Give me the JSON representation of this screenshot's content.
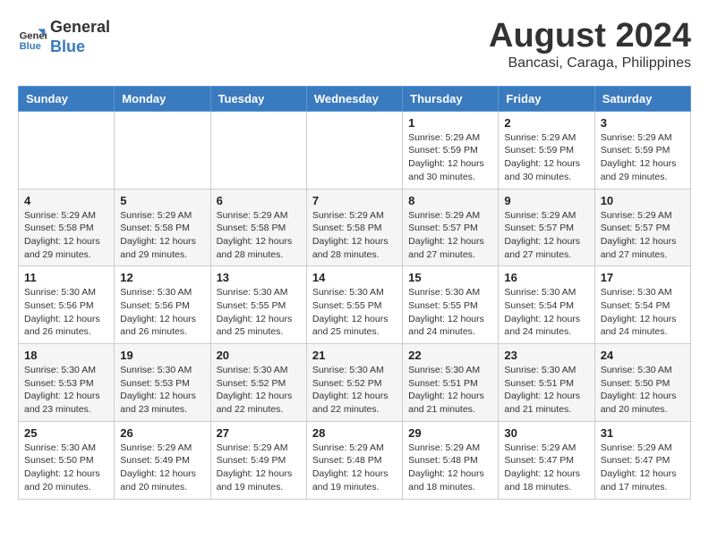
{
  "header": {
    "logo_line1": "General",
    "logo_line2": "Blue",
    "month_title": "August 2024",
    "location": "Bancasi, Caraga, Philippines"
  },
  "weekdays": [
    "Sunday",
    "Monday",
    "Tuesday",
    "Wednesday",
    "Thursday",
    "Friday",
    "Saturday"
  ],
  "weeks": [
    [
      {
        "day": "",
        "info": ""
      },
      {
        "day": "",
        "info": ""
      },
      {
        "day": "",
        "info": ""
      },
      {
        "day": "",
        "info": ""
      },
      {
        "day": "1",
        "info": "Sunrise: 5:29 AM\nSunset: 5:59 PM\nDaylight: 12 hours\nand 30 minutes."
      },
      {
        "day": "2",
        "info": "Sunrise: 5:29 AM\nSunset: 5:59 PM\nDaylight: 12 hours\nand 30 minutes."
      },
      {
        "day": "3",
        "info": "Sunrise: 5:29 AM\nSunset: 5:59 PM\nDaylight: 12 hours\nand 29 minutes."
      }
    ],
    [
      {
        "day": "4",
        "info": "Sunrise: 5:29 AM\nSunset: 5:58 PM\nDaylight: 12 hours\nand 29 minutes."
      },
      {
        "day": "5",
        "info": "Sunrise: 5:29 AM\nSunset: 5:58 PM\nDaylight: 12 hours\nand 29 minutes."
      },
      {
        "day": "6",
        "info": "Sunrise: 5:29 AM\nSunset: 5:58 PM\nDaylight: 12 hours\nand 28 minutes."
      },
      {
        "day": "7",
        "info": "Sunrise: 5:29 AM\nSunset: 5:58 PM\nDaylight: 12 hours\nand 28 minutes."
      },
      {
        "day": "8",
        "info": "Sunrise: 5:29 AM\nSunset: 5:57 PM\nDaylight: 12 hours\nand 27 minutes."
      },
      {
        "day": "9",
        "info": "Sunrise: 5:29 AM\nSunset: 5:57 PM\nDaylight: 12 hours\nand 27 minutes."
      },
      {
        "day": "10",
        "info": "Sunrise: 5:29 AM\nSunset: 5:57 PM\nDaylight: 12 hours\nand 27 minutes."
      }
    ],
    [
      {
        "day": "11",
        "info": "Sunrise: 5:30 AM\nSunset: 5:56 PM\nDaylight: 12 hours\nand 26 minutes."
      },
      {
        "day": "12",
        "info": "Sunrise: 5:30 AM\nSunset: 5:56 PM\nDaylight: 12 hours\nand 26 minutes."
      },
      {
        "day": "13",
        "info": "Sunrise: 5:30 AM\nSunset: 5:55 PM\nDaylight: 12 hours\nand 25 minutes."
      },
      {
        "day": "14",
        "info": "Sunrise: 5:30 AM\nSunset: 5:55 PM\nDaylight: 12 hours\nand 25 minutes."
      },
      {
        "day": "15",
        "info": "Sunrise: 5:30 AM\nSunset: 5:55 PM\nDaylight: 12 hours\nand 24 minutes."
      },
      {
        "day": "16",
        "info": "Sunrise: 5:30 AM\nSunset: 5:54 PM\nDaylight: 12 hours\nand 24 minutes."
      },
      {
        "day": "17",
        "info": "Sunrise: 5:30 AM\nSunset: 5:54 PM\nDaylight: 12 hours\nand 24 minutes."
      }
    ],
    [
      {
        "day": "18",
        "info": "Sunrise: 5:30 AM\nSunset: 5:53 PM\nDaylight: 12 hours\nand 23 minutes."
      },
      {
        "day": "19",
        "info": "Sunrise: 5:30 AM\nSunset: 5:53 PM\nDaylight: 12 hours\nand 23 minutes."
      },
      {
        "day": "20",
        "info": "Sunrise: 5:30 AM\nSunset: 5:52 PM\nDaylight: 12 hours\nand 22 minutes."
      },
      {
        "day": "21",
        "info": "Sunrise: 5:30 AM\nSunset: 5:52 PM\nDaylight: 12 hours\nand 22 minutes."
      },
      {
        "day": "22",
        "info": "Sunrise: 5:30 AM\nSunset: 5:51 PM\nDaylight: 12 hours\nand 21 minutes."
      },
      {
        "day": "23",
        "info": "Sunrise: 5:30 AM\nSunset: 5:51 PM\nDaylight: 12 hours\nand 21 minutes."
      },
      {
        "day": "24",
        "info": "Sunrise: 5:30 AM\nSunset: 5:50 PM\nDaylight: 12 hours\nand 20 minutes."
      }
    ],
    [
      {
        "day": "25",
        "info": "Sunrise: 5:30 AM\nSunset: 5:50 PM\nDaylight: 12 hours\nand 20 minutes."
      },
      {
        "day": "26",
        "info": "Sunrise: 5:29 AM\nSunset: 5:49 PM\nDaylight: 12 hours\nand 20 minutes."
      },
      {
        "day": "27",
        "info": "Sunrise: 5:29 AM\nSunset: 5:49 PM\nDaylight: 12 hours\nand 19 minutes."
      },
      {
        "day": "28",
        "info": "Sunrise: 5:29 AM\nSunset: 5:48 PM\nDaylight: 12 hours\nand 19 minutes."
      },
      {
        "day": "29",
        "info": "Sunrise: 5:29 AM\nSunset: 5:48 PM\nDaylight: 12 hours\nand 18 minutes."
      },
      {
        "day": "30",
        "info": "Sunrise: 5:29 AM\nSunset: 5:47 PM\nDaylight: 12 hours\nand 18 minutes."
      },
      {
        "day": "31",
        "info": "Sunrise: 5:29 AM\nSunset: 5:47 PM\nDaylight: 12 hours\nand 17 minutes."
      }
    ]
  ]
}
